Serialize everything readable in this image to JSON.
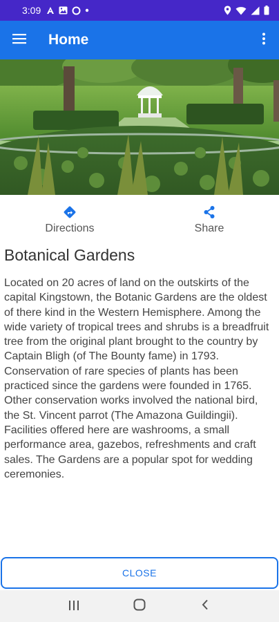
{
  "status_bar": {
    "time": "3:09",
    "left_icons": [
      "notification-a-icon",
      "gallery-icon",
      "circle-icon",
      "dot-icon"
    ],
    "right_icons": [
      "location-icon",
      "wifi-icon",
      "signal-icon",
      "battery-icon"
    ]
  },
  "app_bar": {
    "title": "Home",
    "menu_icon": "hamburger-menu-icon",
    "overflow_icon": "more-vert-icon"
  },
  "hero": {
    "subject": "Botanical gardens photo with gazebo"
  },
  "actions": [
    {
      "label": "Directions",
      "icon": "directions-icon"
    },
    {
      "label": "Share",
      "icon": "share-icon"
    }
  ],
  "place": {
    "title": "Botanical Gardens",
    "description": "Located on 20 acres of land on the outskirts of the capital Kingstown, the Botanic Gardens are the oldest of there kind in the Western Hemisphere. Among the wide variety of tropical trees and shrubs is a breadfruit tree from the original plant brought to the country by Captain Bligh (of The Bounty fame) in 1793. Conservation of rare species of plants has been practiced since the gardens were founded in 1765. Other conservation works involved the national bird, the St. Vincent parrot (The Amazona Guildingii). Facilities offered here are washrooms, a small performance area, gazebos, refreshments and craft sales. The Gardens are a popular spot for wedding ceremonies."
  },
  "close_button": {
    "label": "CLOSE"
  },
  "nav_bar": {
    "buttons": [
      "recents-icon",
      "home-icon",
      "back-icon"
    ]
  },
  "colors": {
    "status_bar": "#4527c8",
    "app_bar": "#1a73e8",
    "accent": "#1a73e8"
  }
}
